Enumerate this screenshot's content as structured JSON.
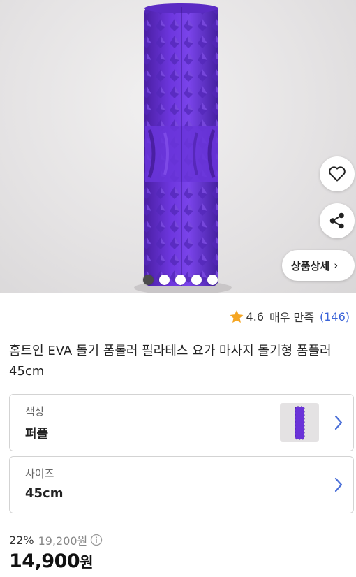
{
  "product": {
    "title": "홈트인 EVA 돌기 폼롤러 필라테스 요가 마사지 돌기형 폼플러 45cm",
    "detail_button_label": "상품상세",
    "image_slide_count": 5,
    "active_slide_index": 0,
    "accent_color": "#6c32d9"
  },
  "rating": {
    "icon": "star-icon",
    "score": "4.6",
    "label": "매우 만족",
    "count": "(146)"
  },
  "options": {
    "color": {
      "label": "색상",
      "value": "퍼플"
    },
    "size": {
      "label": "사이즈",
      "value": "45cm"
    }
  },
  "price": {
    "discount": "22%",
    "original": "19,200원",
    "final": "14,900",
    "unit": "원"
  },
  "icons": [
    "heart-icon",
    "share-icon",
    "chevron-right-icon",
    "info-icon",
    "star-icon"
  ]
}
